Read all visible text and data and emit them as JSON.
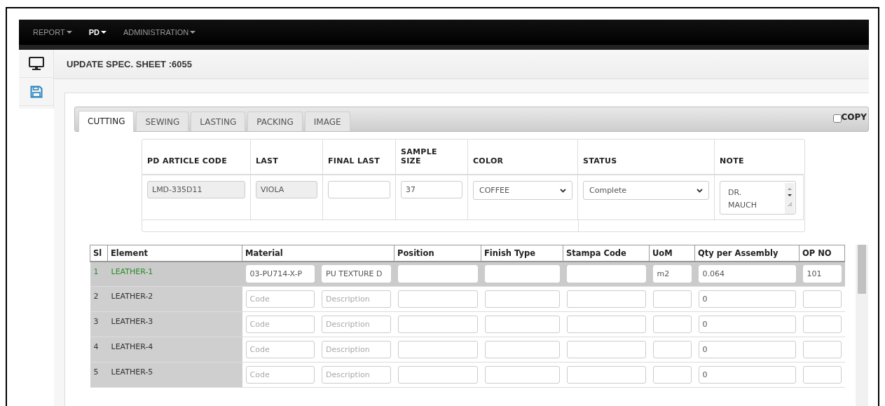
{
  "nav": {
    "items": [
      {
        "label": "REPORT",
        "selected": false
      },
      {
        "label": "PD",
        "selected": true
      },
      {
        "label": "ADMINISTRATION",
        "selected": false
      }
    ]
  },
  "page_title": "UPDATE SPEC. SHEET :6055",
  "tabs": [
    {
      "label": "CUTTING",
      "selected": true
    },
    {
      "label": "SEWING",
      "selected": false
    },
    {
      "label": "LASTING",
      "selected": false
    },
    {
      "label": "PACKING",
      "selected": false
    },
    {
      "label": "IMAGE",
      "selected": false
    }
  ],
  "copy": {
    "label": "COPY",
    "checked": false
  },
  "spec": {
    "columns": [
      "PD ARTICLE CODE",
      "LAST",
      "FINAL LAST",
      "SAMPLE SIZE",
      "COLOR",
      "STATUS",
      "NOTE"
    ],
    "fields": [
      {
        "kind": "input",
        "value": "LMD-335D11",
        "disabled": true
      },
      {
        "kind": "input",
        "value": "VIOLA",
        "disabled": true
      },
      {
        "kind": "input",
        "disabled": false
      },
      {
        "kind": "input",
        "value": "37",
        "disabled": false
      },
      {
        "kind": "select",
        "value": "COFFEE",
        "disabled": false
      },
      {
        "kind": "select",
        "value": "Complete",
        "disabled": false
      },
      {
        "kind": "textarea",
        "value": "DR. MAUCH",
        "disabled": false
      }
    ]
  },
  "grid": {
    "columns": [
      "Sl",
      "Element",
      "Material",
      "Position",
      "Finish Type",
      "Stampa Code",
      "UoM",
      "Qty per Assembly",
      "OP NO"
    ],
    "rows": [
      {
        "sl": "1",
        "element": "LEATHER-1",
        "selected": true,
        "code": "03-PU714-X-P",
        "description": "PU TEXTURE D",
        "uom": "m2",
        "qty": "0.064",
        "op_no": "101"
      },
      {
        "sl": "2",
        "element": "LEATHER-2",
        "selected": false,
        "code_placeholder": "Code",
        "description_placeholder": "Description",
        "qty": "0"
      },
      {
        "sl": "3",
        "element": "LEATHER-3",
        "selected": false,
        "code_placeholder": "Code",
        "description_placeholder": "Description",
        "qty": "0"
      },
      {
        "sl": "4",
        "element": "LEATHER-4",
        "selected": false,
        "code_placeholder": "Code",
        "description_placeholder": "Description",
        "qty": "0"
      },
      {
        "sl": "5",
        "element": "LEATHER-5",
        "selected": false,
        "code_placeholder": "Code",
        "description_placeholder": "Description",
        "qty": "0"
      }
    ]
  }
}
